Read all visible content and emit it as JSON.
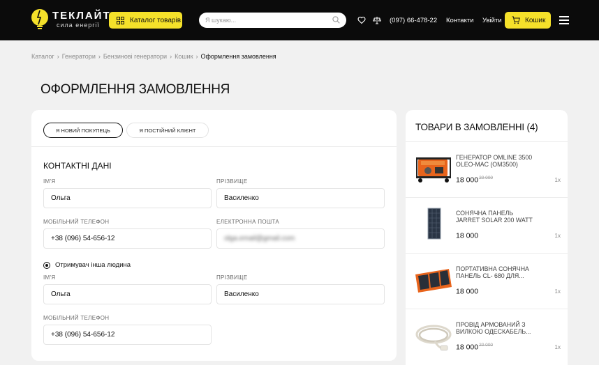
{
  "header": {
    "logo_title": "ТЕКЛАЙТ",
    "logo_subtitle": "сила енергії",
    "catalog_label": "Каталог товарів",
    "search_placeholder": "Я шукаю...",
    "phone": "(097) 66-478-22",
    "contacts_label": "Контакти",
    "login_label": "Увійти",
    "cart_label": "Кошик",
    "icons": [
      "heart-icon",
      "compare-icon",
      "cart-icon",
      "menu-icon",
      "search-icon",
      "grid-icon"
    ],
    "accent_color": "#f5e12a"
  },
  "breadcrumbs": [
    "Каталог",
    "Генератори",
    "Бензинові генератори",
    "Кошик",
    "Оформлення замовлення"
  ],
  "page_title": "ОФОРМЛЕННЯ ЗАМОВЛЕННЯ",
  "form": {
    "tabs": [
      "Я НОВИЙ ПОКУПЕЦЬ",
      "Я ПОСТІЙНИЙ КЛІЄНТ"
    ],
    "active_tab": 0,
    "section_title": "КОНТАКТНІ ДАНІ",
    "first_name_label": "ІМ'Я",
    "first_name_value": "Ольга",
    "last_name_label": "ПРІЗВИЩЕ",
    "last_name_value": "Василенко",
    "phone_label": "МОБІЛЬНИЙ ТЕЛЕФОН",
    "phone_value": "+38 (096) 54-656-12",
    "email_label": "ЕЛЕКТРОННА ПОШТА",
    "email_value": "olga.email@gmail.com",
    "recipient_label": "Отримувач інша людина",
    "recipient_checked": true,
    "recipient": {
      "first_name_label": "ІМ'Я",
      "first_name_value": "Ольга",
      "last_name_label": "ПРІЗВИЩЕ",
      "last_name_value": "Василенко",
      "phone_label": "МОБІЛЬНИЙ ТЕЛЕФОН",
      "phone_value": "+38 (096) 54-656-12"
    }
  },
  "order": {
    "title": "ТОВАРИ В ЗАМОВЛЕННІ (4)",
    "items": [
      {
        "name": "ГЕНЕРАТОР OMLINE 3500 OLEO-MAC (OM3500)",
        "price": "18 000",
        "old_price": "20 000",
        "qty": "1x",
        "image": "generator-image"
      },
      {
        "name": "СОНЯЧНА ПАНЕЛЬ JARRET SOLAR 200 WATT",
        "price": "18 000",
        "old_price": "",
        "qty": "1x",
        "image": "solar-panel-image"
      },
      {
        "name": "ПОРТАТИВНА СОНЯЧНА ПАНЕЛЬ CL- 680 ДЛЯ...",
        "price": "18 000",
        "old_price": "",
        "qty": "1x",
        "image": "portable-solar-image"
      },
      {
        "name": "ПРОВІД АРМОВАНИЙ З ВИЛКОЮ ОДЕСКАБЕЛЬ...",
        "price": "18 000",
        "old_price": "20 000",
        "qty": "1x",
        "image": "cable-image"
      }
    ]
  }
}
